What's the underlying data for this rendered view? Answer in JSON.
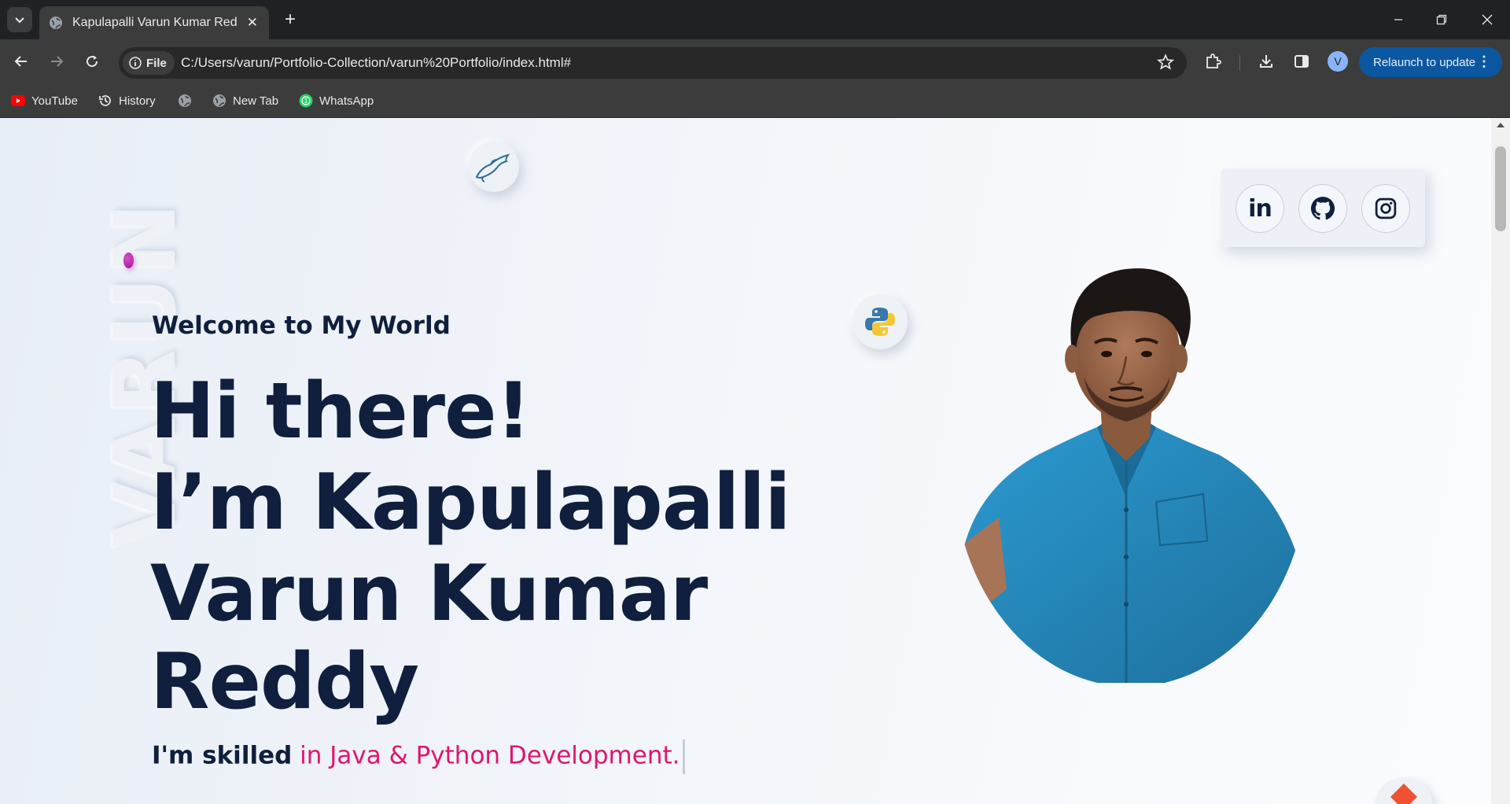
{
  "browser": {
    "tab_title": "Kapulapalli Varun Kumar Reddy",
    "omnibox_chip": "File",
    "url": "C:/Users/varun/Portfolio-Collection/varun%20Portfolio/index.html#",
    "profile_initial": "V",
    "relaunch_label": "Relaunch to update",
    "bookmarks": [
      {
        "label": "YouTube",
        "icon": "youtube-icon"
      },
      {
        "label": "History",
        "icon": "history-icon"
      },
      {
        "label": "",
        "icon": "globe-icon"
      },
      {
        "label": "New Tab",
        "icon": "globe-icon"
      },
      {
        "label": "WhatsApp",
        "icon": "whatsapp-icon"
      }
    ]
  },
  "hero": {
    "watermark": "VARUN",
    "welcome": "Welcome to My World",
    "line1": "Hi there!",
    "line2": "I’m Kapulapalli",
    "line3": "Varun Kumar",
    "line4": "Reddy",
    "skill_lead": "I'm skilled",
    "skill_typed": "in Java & Python Development."
  },
  "social": [
    {
      "name": "linkedin",
      "label": "in"
    },
    {
      "name": "github",
      "icon": "github-icon"
    },
    {
      "name": "instagram",
      "icon": "instagram-icon"
    }
  ],
  "colors": {
    "accent_pink": "#e0156e",
    "heading_navy": "#0f1f3d",
    "relaunch_blue": "#0b57a0",
    "shirt_blue": "#2a8fc4"
  }
}
